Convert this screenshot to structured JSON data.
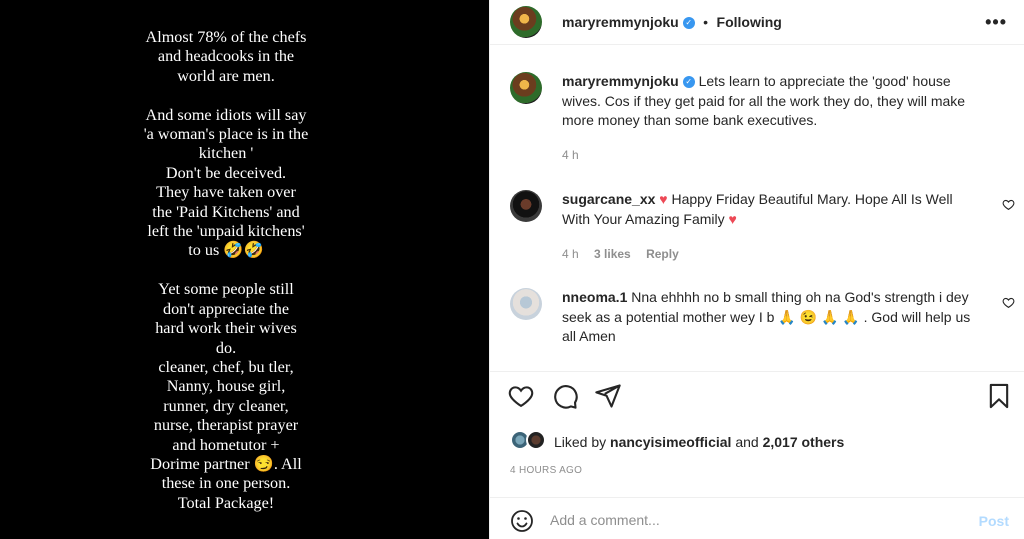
{
  "image_text": "Almost 78% of the chefs\nand headcooks in the\nworld are men.\n\nAnd some idiots will say\n'a woman's place is in the\nkitchen '\nDon't be deceived.\nThey have taken over\nthe 'Paid Kitchens' and\nleft the 'unpaid kitchens'\nto us 🤣🤣\n\nYet some people still\ndon't appreciate the\nhard work their wives\ndo.\ncleaner, chef, bu  tler,\nNanny, house girl,\nrunner, dry cleaner,\nnurse, therapist prayer\nand hometutor +\nDorime partner 😏. All\nthese in one person.\nTotal Package!",
  "header": {
    "username": "maryremmynjoku",
    "separator": "•",
    "following_label": "Following",
    "more_icon": "more-horizontal-icon"
  },
  "caption": {
    "username": "maryremmynjoku",
    "text": "Lets learn to appreciate the 'good' house wives. Cos if they get paid for all the work they do, they will make more money than some bank executives.",
    "time": "4 h"
  },
  "comments": [
    {
      "username": "sugarcane_xx",
      "text_before": " ",
      "heart1": "♥",
      "text": " Happy Friday Beautiful Mary. Hope All Is Well With Your Amazing Family ",
      "heart2": "♥",
      "time": "4 h",
      "likes": "3 likes",
      "reply": "Reply"
    },
    {
      "username": "nneoma.1",
      "text": " Nna ehhhh no b small thing oh na God's strength i dey seek as a potential mother wey I b 🙏 😉 🙏 🙏 . God will help us all Amen"
    }
  ],
  "likes": {
    "prefix": "Liked by ",
    "user": "nancyisimeofficial",
    "middle": " and ",
    "others": "2,017 others"
  },
  "timestamp": "4 HOURS AGO",
  "add_comment": {
    "placeholder": "Add a comment...",
    "post_label": "Post"
  },
  "colors": {
    "accent": "#3897f0",
    "heart_red": "#ed4956",
    "post_disabled": "#b3dbff"
  }
}
